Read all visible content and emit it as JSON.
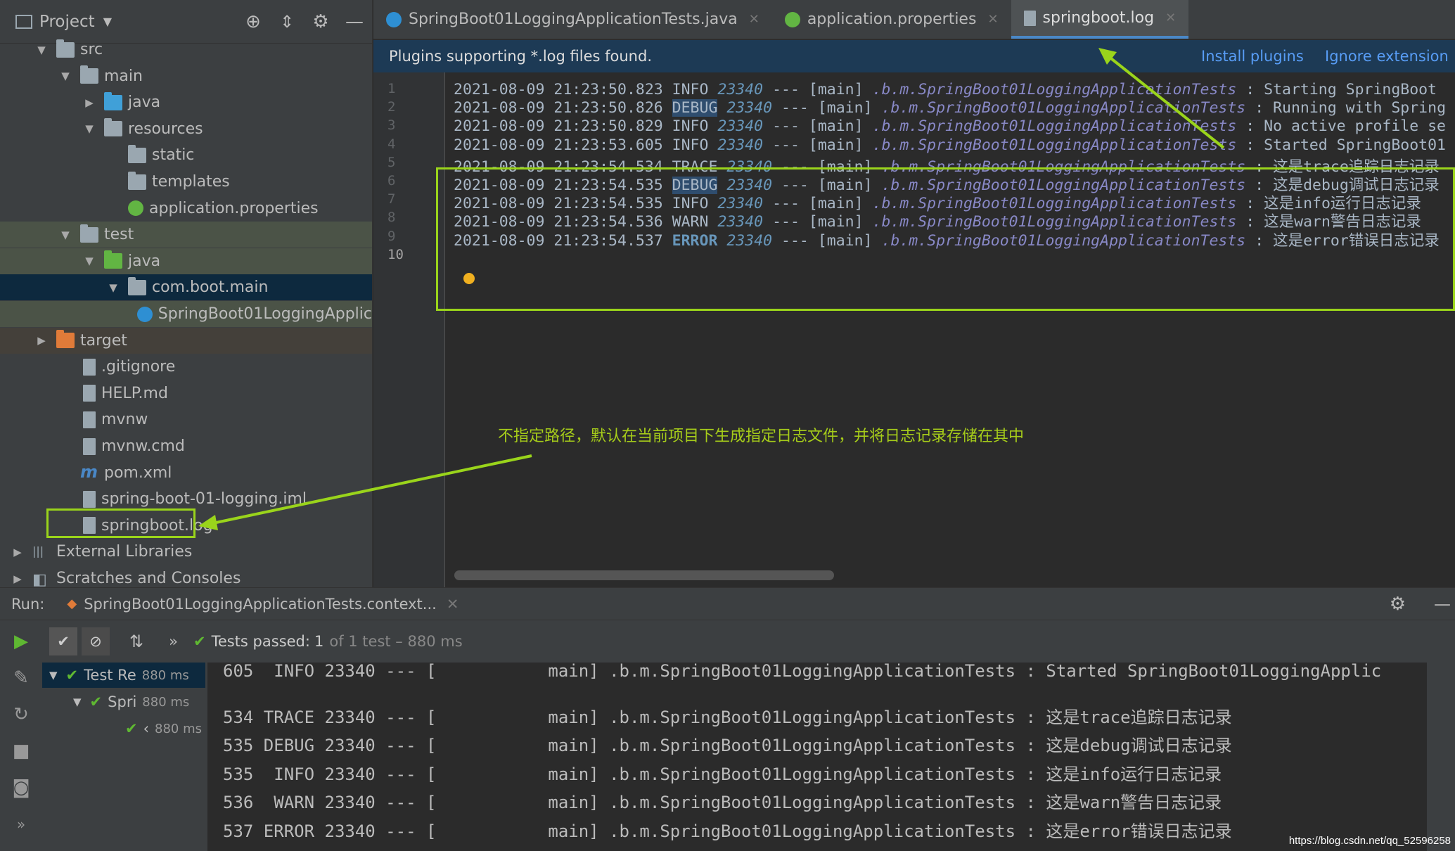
{
  "project": {
    "title": "Project",
    "tree": [
      {
        "label": "src",
        "indent": 1,
        "arrow": "▼",
        "icon": "folder"
      },
      {
        "label": "main",
        "indent": 2,
        "arrow": "▼",
        "icon": "folder"
      },
      {
        "label": "java",
        "indent": 3,
        "arrow": "▶",
        "icon": "folder-blue"
      },
      {
        "label": "resources",
        "indent": 3,
        "arrow": "▼",
        "icon": "folder"
      },
      {
        "label": "static",
        "indent": 4,
        "arrow": "",
        "icon": "folder"
      },
      {
        "label": "templates",
        "indent": 4,
        "arrow": "",
        "icon": "folder"
      },
      {
        "label": "application.properties",
        "indent": 4,
        "arrow": "",
        "icon": "properties"
      },
      {
        "label": "test",
        "indent": 2,
        "arrow": "▼",
        "icon": "folder"
      },
      {
        "label": "java",
        "indent": 3,
        "arrow": "▼",
        "icon": "folder-green"
      },
      {
        "label": "com.boot.main",
        "indent": 4,
        "arrow": "▼",
        "icon": "package"
      },
      {
        "label": "SpringBoot01LoggingApplic",
        "indent": 5,
        "arrow": "",
        "icon": "class"
      },
      {
        "label": "target",
        "indent": 1,
        "arrow": "▶",
        "icon": "folder-orange"
      },
      {
        "label": ".gitignore",
        "indent": 2,
        "arrow": "",
        "icon": "file"
      },
      {
        "label": "HELP.md",
        "indent": 2,
        "arrow": "",
        "icon": "file"
      },
      {
        "label": "mvnw",
        "indent": 2,
        "arrow": "",
        "icon": "file"
      },
      {
        "label": "mvnw.cmd",
        "indent": 2,
        "arrow": "",
        "icon": "file"
      },
      {
        "label": "pom.xml",
        "indent": 2,
        "arrow": "",
        "icon": "maven"
      },
      {
        "label": "spring-boot-01-logging.iml",
        "indent": 2,
        "arrow": "",
        "icon": "file"
      },
      {
        "label": "springboot.log",
        "indent": 2,
        "arrow": "",
        "icon": "file"
      },
      {
        "label": "External Libraries",
        "indent": 0,
        "arrow": "▶",
        "icon": "libraries"
      },
      {
        "label": "Scratches and Consoles",
        "indent": 0,
        "arrow": "▶",
        "icon": "scratches"
      }
    ]
  },
  "tabs": [
    {
      "label": "SpringBoot01LoggingApplicationTests.java",
      "icon": "class"
    },
    {
      "label": "application.properties",
      "icon": "properties"
    },
    {
      "label": "springboot.log",
      "icon": "file"
    }
  ],
  "banner": {
    "text": "Plugins supporting *.log files found.",
    "install": "Install plugins",
    "ignore": "Ignore extension"
  },
  "editor": {
    "lines": [
      {
        "n": "1",
        "date": "2021-08-09 21:23:50.823",
        "level": " INFO",
        "pid": "23340",
        "sep": "---",
        "thread": "[main]",
        "logger": ".b.m.SpringBoot01LoggingApplicationTests",
        "msg": ": Starting SpringBoot"
      },
      {
        "n": "2",
        "date": "2021-08-09 21:23:50.826",
        "level": "DEBUG",
        "pid": "23340",
        "sep": "---",
        "thread": "[main]",
        "logger": ".b.m.SpringBoot01LoggingApplicationTests",
        "msg": ": Running with Spring"
      },
      {
        "n": "3",
        "date": "2021-08-09 21:23:50.829",
        "level": " INFO",
        "pid": "23340",
        "sep": "---",
        "thread": "[main]",
        "logger": ".b.m.SpringBoot01LoggingApplicationTests",
        "msg": ": No active profile se"
      },
      {
        "n": "4",
        "date": "2021-08-09 21:23:53.605",
        "level": " INFO",
        "pid": "23340",
        "sep": "---",
        "thread": "[main]",
        "logger": ".b.m.SpringBoot01LoggingApplicationTests",
        "msg": ": Started SpringBoot01"
      },
      {
        "n": "5",
        "date": "2021-08-09 21:23:54.534",
        "level": "TRACE",
        "pid": "23340",
        "sep": "---",
        "thread": "[main]",
        "logger": ".b.m.SpringBoot01LoggingApplicationTests",
        "msg": ": 这是trace追踪日志记录"
      },
      {
        "n": "6",
        "date": "2021-08-09 21:23:54.535",
        "level": "DEBUG",
        "pid": "23340",
        "sep": "---",
        "thread": "[main]",
        "logger": ".b.m.SpringBoot01LoggingApplicationTests",
        "msg": ": 这是debug调试日志记录"
      },
      {
        "n": "7",
        "date": "2021-08-09 21:23:54.535",
        "level": " INFO",
        "pid": "23340",
        "sep": "---",
        "thread": "[main]",
        "logger": ".b.m.SpringBoot01LoggingApplicationTests",
        "msg": ": 这是info运行日志记录"
      },
      {
        "n": "8",
        "date": "2021-08-09 21:23:54.536",
        "level": " WARN",
        "pid": "23340",
        "sep": "---",
        "thread": "[main]",
        "logger": ".b.m.SpringBoot01LoggingApplicationTests",
        "msg": ": 这是warn警告日志记录"
      },
      {
        "n": "9",
        "date": "2021-08-09 21:23:54.537",
        "level": "ERROR",
        "pid": "23340",
        "sep": "---",
        "thread": "[main]",
        "logger": ".b.m.SpringBoot01LoggingApplicationTests",
        "msg": ": 这是error错误日志记录"
      },
      {
        "n": "10",
        "date": "",
        "level": "",
        "pid": "",
        "sep": "",
        "thread": "",
        "logger": "",
        "msg": ""
      }
    ]
  },
  "annotation": "不指定路径，默认在当前项目下生成指定日志文件，并将日志记录存储在其中",
  "run": {
    "label": "Run:",
    "config": "SpringBoot01LoggingApplicationTests.context...",
    "status": "Tests passed:",
    "count": "1",
    "of": "of 1 test – 880 ms",
    "tree": [
      {
        "label": "Test Re",
        "time": "880 ms"
      },
      {
        "label": "Spri",
        "time": "880 ms"
      },
      {
        "label": "‹",
        "time": "880 ms"
      }
    ],
    "console": [
      "605  INFO 23340 --- [           main] .b.m.SpringBoot01LoggingApplicationTests : Started SpringBoot01LoggingApplic",
      "",
      "534 TRACE 23340 --- [           main] .b.m.SpringBoot01LoggingApplicationTests : 这是trace追踪日志记录",
      "535 DEBUG 23340 --- [           main] .b.m.SpringBoot01LoggingApplicationTests : 这是debug调试日志记录",
      "535  INFO 23340 --- [           main] .b.m.SpringBoot01LoggingApplicationTests : 这是info运行日志记录",
      "536  WARN 23340 --- [           main] .b.m.SpringBoot01LoggingApplicationTests : 这是warn警告日志记录",
      "537 ERROR 23340 --- [           main] .b.m.SpringBoot01LoggingApplicationTests : 这是error错误日志记录"
    ]
  },
  "watermark": "https://blog.csdn.net/qq_52596258",
  "colors": {
    "accent": "#9ad41b",
    "link": "#589df6",
    "selection": "#0d293e"
  }
}
